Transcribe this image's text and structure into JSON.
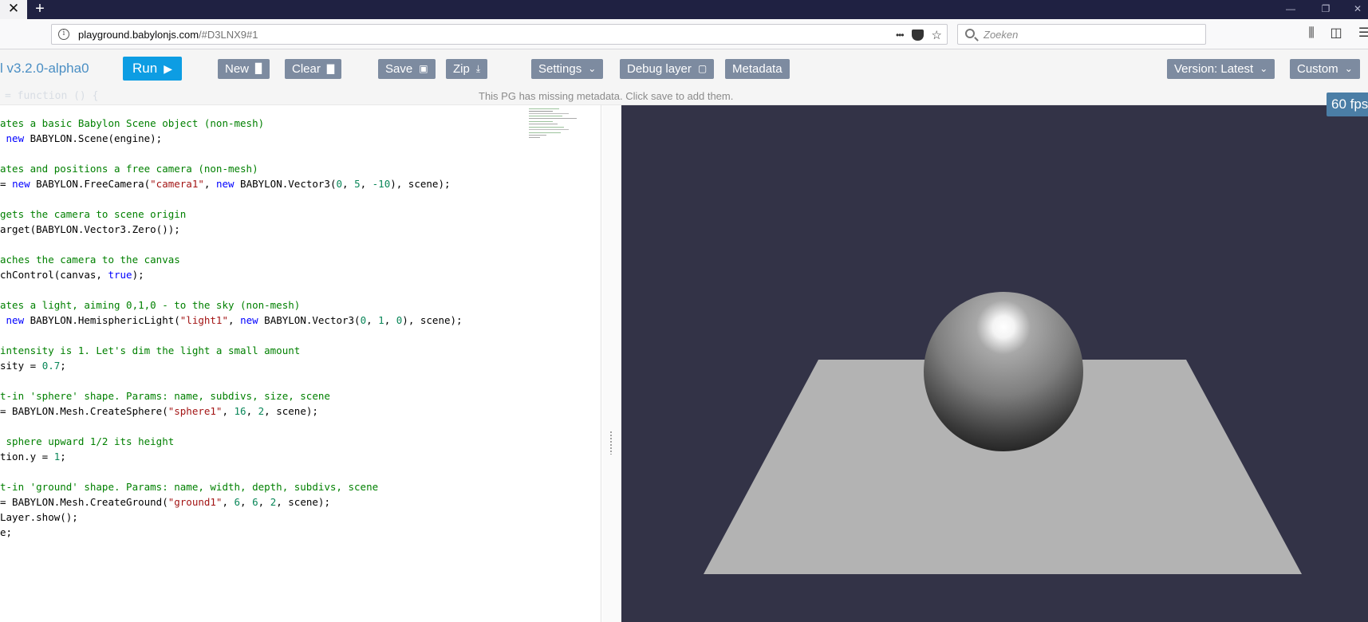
{
  "browser": {
    "url_host": "playground.babylonjs.com",
    "url_path": "/#D3LNX9#1",
    "search_placeholder": "Zoeken",
    "more_glyph": "•••"
  },
  "toolbar": {
    "version_label": "l v3.2.0-alpha0",
    "run_label": "Run",
    "new_label": "New",
    "clear_label": "Clear",
    "save_label": "Save",
    "zip_label": "Zip",
    "settings_label": "Settings",
    "debug_label": "Debug layer",
    "metadata_label": "Metadata",
    "version_select_label": "Version: Latest",
    "custom_label": "Custom"
  },
  "metadata_message": "This PG has missing metadata. Click save to add them.",
  "ghost_code": "= function () {",
  "fps": "60 fps",
  "code_lines": [
    [
      [
        "c-cm",
        "ates a basic Babylon Scene object (non-mesh)"
      ]
    ],
    [
      [
        "",
        " "
      ],
      [
        "c-kw",
        "new"
      ],
      [
        "",
        " BABYLON.Scene(engine);"
      ]
    ],
    [],
    [
      [
        "c-cm",
        "ates and positions a free camera (non-mesh)"
      ]
    ],
    [
      [
        "",
        "= "
      ],
      [
        "c-kw",
        "new"
      ],
      [
        "",
        " BABYLON.FreeCamera("
      ],
      [
        "c-st",
        "\"camera1\""
      ],
      [
        "",
        ", "
      ],
      [
        "c-kw",
        "new"
      ],
      [
        "",
        " BABYLON.Vector3("
      ],
      [
        "c-nm",
        "0"
      ],
      [
        "",
        ", "
      ],
      [
        "c-nm",
        "5"
      ],
      [
        "",
        ", "
      ],
      [
        "c-nm",
        "-10"
      ],
      [
        "",
        "), scene);"
      ]
    ],
    [],
    [
      [
        "c-cm",
        "gets the camera to scene origin"
      ]
    ],
    [
      [
        "",
        "arget(BABYLON.Vector3.Zero());"
      ]
    ],
    [],
    [
      [
        "c-cm",
        "aches the camera to the canvas"
      ]
    ],
    [
      [
        "",
        "chControl(canvas, "
      ],
      [
        "c-kw",
        "true"
      ],
      [
        "",
        ");"
      ]
    ],
    [],
    [
      [
        "c-cm",
        "ates a light, aiming 0,1,0 - to the sky (non-mesh)"
      ]
    ],
    [
      [
        "",
        " "
      ],
      [
        "c-kw",
        "new"
      ],
      [
        "",
        " BABYLON.HemisphericLight("
      ],
      [
        "c-st",
        "\"light1\""
      ],
      [
        "",
        ", "
      ],
      [
        "c-kw",
        "new"
      ],
      [
        "",
        " BABYLON.Vector3("
      ],
      [
        "c-nm",
        "0"
      ],
      [
        "",
        ", "
      ],
      [
        "c-nm",
        "1"
      ],
      [
        "",
        ", "
      ],
      [
        "c-nm",
        "0"
      ],
      [
        "",
        "), scene);"
      ]
    ],
    [],
    [
      [
        "c-cm",
        "intensity is 1. Let's dim the light a small amount"
      ]
    ],
    [
      [
        "",
        "sity = "
      ],
      [
        "c-nm",
        "0.7"
      ],
      [
        "",
        ";"
      ]
    ],
    [],
    [
      [
        "c-cm",
        "t-in 'sphere' shape. Params: name, subdivs, size, scene"
      ]
    ],
    [
      [
        "",
        "= BABYLON.Mesh.CreateSphere("
      ],
      [
        "c-st",
        "\"sphere1\""
      ],
      [
        "",
        ", "
      ],
      [
        "c-nm",
        "16"
      ],
      [
        "",
        ", "
      ],
      [
        "c-nm",
        "2"
      ],
      [
        "",
        ", scene);"
      ]
    ],
    [],
    [
      [
        "c-cm",
        " sphere upward 1/2 its height"
      ]
    ],
    [
      [
        "",
        "tion.y = "
      ],
      [
        "c-nm",
        "1"
      ],
      [
        "",
        ";"
      ]
    ],
    [],
    [
      [
        "c-cm",
        "t-in 'ground' shape. Params: name, width, depth, subdivs, scene"
      ]
    ],
    [
      [
        "",
        "= BABYLON.Mesh.CreateGround("
      ],
      [
        "c-st",
        "\"ground1\""
      ],
      [
        "",
        ", "
      ],
      [
        "c-nm",
        "6"
      ],
      [
        "",
        ", "
      ],
      [
        "c-nm",
        "6"
      ],
      [
        "",
        ", "
      ],
      [
        "c-nm",
        "2"
      ],
      [
        "",
        ", scene);"
      ]
    ],
    [
      [
        "",
        "Layer.show();"
      ]
    ],
    [
      [
        "",
        "e;"
      ]
    ]
  ],
  "scene": {
    "background_color": "#333347",
    "ground_color": "#b3b3b3",
    "accent_color": "#0d9de3",
    "button_color": "#7d8ba0"
  }
}
